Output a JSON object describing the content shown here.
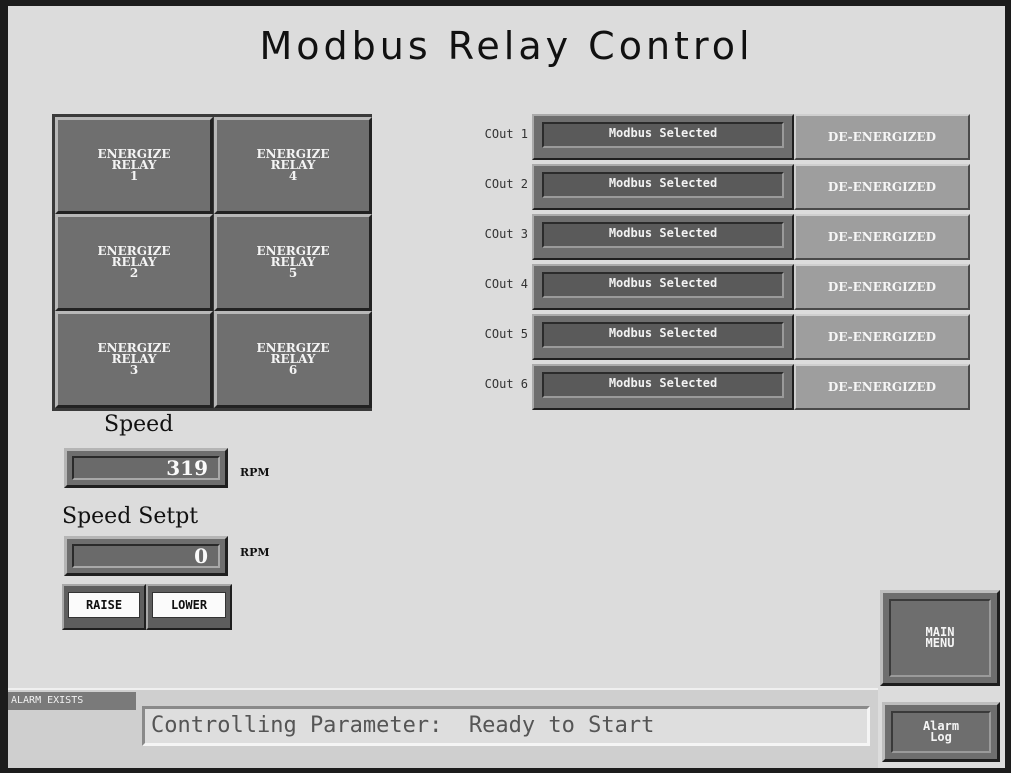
{
  "title": "Modbus Relay Control",
  "relays": [
    {
      "label": "ENERGIZE\nRELAY\n1"
    },
    {
      "label": "ENERGIZE\nRELAY\n4"
    },
    {
      "label": "ENERGIZE\nRELAY\n2"
    },
    {
      "label": "ENERGIZE\nRELAY\n5"
    },
    {
      "label": "ENERGIZE\nRELAY\n3"
    },
    {
      "label": "ENERGIZE\nRELAY\n6"
    }
  ],
  "outputs": [
    {
      "label": "COut 1",
      "source": "Modbus Selected",
      "state": "DE-ENERGIZED"
    },
    {
      "label": "COut 2",
      "source": "Modbus Selected",
      "state": "DE-ENERGIZED"
    },
    {
      "label": "COut 3",
      "source": "Modbus Selected",
      "state": "DE-ENERGIZED"
    },
    {
      "label": "COut 4",
      "source": "Modbus Selected",
      "state": "DE-ENERGIZED"
    },
    {
      "label": "COut 5",
      "source": "Modbus Selected",
      "state": "DE-ENERGIZED"
    },
    {
      "label": "COut 6",
      "source": "Modbus Selected",
      "state": "DE-ENERGIZED"
    }
  ],
  "speed": {
    "label": "Speed",
    "value": "319",
    "unit": "RPM"
  },
  "setpoint": {
    "label": "Speed Setpt",
    "value": "0",
    "unit": "RPM",
    "raise_label": "RAISE",
    "lower_label": "LOWER"
  },
  "nav": {
    "main_menu": "MAIN\nMENU",
    "alarm_log": "Alarm\nLog"
  },
  "status": {
    "alarm": "ALARM EXISTS",
    "message": "Controlling Parameter:  Ready to Start"
  }
}
